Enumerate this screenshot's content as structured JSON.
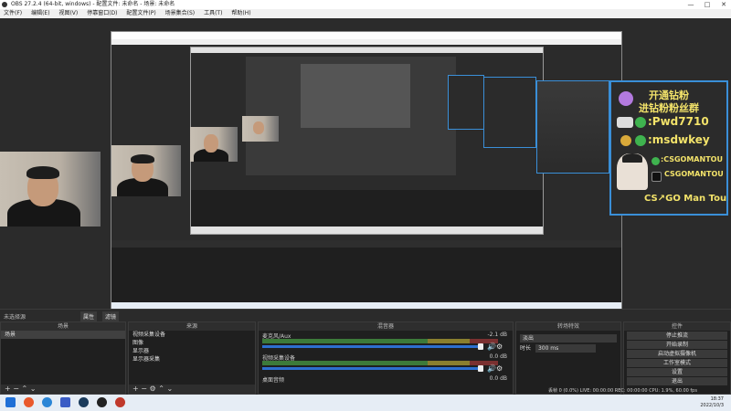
{
  "window": {
    "title": "OBS 27.2.4 (64-bit, windows) - 配置文件: 未命名 - 场景: 未命名",
    "minimize": "—",
    "maximize": "□",
    "close": "✕"
  },
  "menu": [
    "文件(F)",
    "编辑(E)",
    "视图(V)",
    "停靠窗口(D)",
    "配置文件(P)",
    "场景集合(S)",
    "工具(T)",
    "帮助(H)"
  ],
  "promo": {
    "title_1": "开通钻粉",
    "title_2": "进钻粉粉丝群",
    "id_1": ":Pwd7710",
    "id_2": ":msdwkey",
    "handle_1": ":CSGOMANTOU",
    "handle_2": "CSGOMANTOU",
    "footer": "CS↗GO Man Tou"
  },
  "statusbar": {
    "no_source": "未选择源",
    "props": "属性",
    "filters": "滤镜"
  },
  "docks": {
    "scenes": {
      "header": "场景",
      "items": [
        "场景"
      ],
      "footer": "+  −  ⌃  ⌄"
    },
    "sources": {
      "header": "来源",
      "items": [
        "视频采集设备",
        "图像",
        "显示器",
        "显示器采集"
      ],
      "footer": "+  −  ⚙  ⌃  ⌄"
    },
    "mixer": {
      "header": "混音器",
      "channels": [
        {
          "name": "麦克风/Aux",
          "db": "-2.1 dB"
        },
        {
          "name": "视频采集设备",
          "db": "0.0 dB"
        },
        {
          "name": "桌面音频",
          "db": "0.0 dB"
        }
      ]
    },
    "transitions": {
      "header": "转场特效",
      "type": "淡出",
      "duration_label": "时长",
      "duration": "300 ms"
    },
    "controls": {
      "header": "控件",
      "buttons": [
        "停止推流",
        "开始录制",
        "启动虚拟摄像机",
        "工作室模式",
        "设置",
        "退出"
      ]
    }
  },
  "status": {
    "dropped": "丢帧 0 (0.0%)",
    "live": "LIVE: 00:00:00",
    "rec": "REC: 00:00:00",
    "cpu": "CPU: 1.9%, 60.00 fps"
  },
  "taskbar": {
    "time": "18:37",
    "date": "2022/10/3"
  },
  "colors": {
    "accent": "#2d6fd0",
    "promo_border": "#3a8fd8",
    "promo_text": "#f3e36a"
  }
}
